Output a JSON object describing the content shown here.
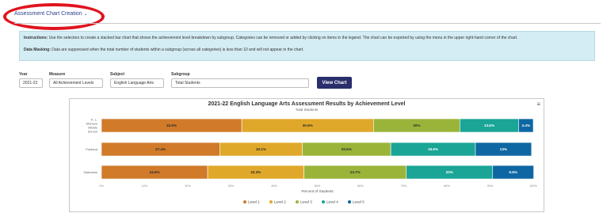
{
  "header": {
    "title": "Assessment Chart Creation",
    "chevron": "⌄"
  },
  "info": {
    "instructions_label": "Instructions:",
    "instructions_text": "Use the selectors to create a stacked bar chart that shows the achievement level breakdown by subgroup. Categories can be removed or added by clicking on items in the legend. The chart can be exported by using the menu in the upper right-hand corner of the chart.",
    "masking_label": "Data Masking:",
    "masking_text": "Data are suppressed when the total number of students within a subgroup (across all categories) is less than 10 and will not appear in the chart."
  },
  "filters": {
    "year": {
      "label": "Year",
      "value": "2021-22"
    },
    "measure": {
      "label": "Measure",
      "value": "All Achievement Levels"
    },
    "subject": {
      "label": "Subject",
      "value": "English Language Arts"
    },
    "subgroup": {
      "label": "Subgroup",
      "value": "Total Students"
    }
  },
  "view_button": "View Chart",
  "colors": {
    "Level 1": "#d07a2a",
    "Level 2": "#e0a82a",
    "Level 3": "#9ab43a",
    "Level 4": "#1aa596",
    "Level 5": "#0e67a3"
  },
  "chart_data": {
    "type": "bar",
    "orientation": "horizontal",
    "stacked": true,
    "title": "2021-22 English Language Arts Assessment Results by Achievement Level",
    "subtitle": "Total Students",
    "xlabel": "Percent of Students",
    "xlim": [
      0,
      100
    ],
    "x_ticks": [
      "0%",
      "10%",
      "20%",
      "30%",
      "40%",
      "50%",
      "60%",
      "70%",
      "80%",
      "90%",
      "100%"
    ],
    "categories": [
      [
        "K. L.",
        "Mohave",
        "Middle",
        "School"
      ],
      [
        "Portland"
      ],
      [
        "Statewide"
      ]
    ],
    "series": [
      {
        "name": "Level 1",
        "values": [
          32.5,
          27.4,
          24.6
        ],
        "labels": [
          "32.5%",
          "27.4%",
          "24.6%"
        ]
      },
      {
        "name": "Level 2",
        "values": [
          30.5,
          19.1,
          22.3
        ],
        "labels": [
          "30.5%",
          "19.1%",
          "22.3%"
        ]
      },
      {
        "name": "Level 3",
        "values": [
          20,
          20.5,
          23.7
        ],
        "labels": [
          "20%",
          "20.5%",
          "23.7%"
        ]
      },
      {
        "name": "Level 4",
        "values": [
          13.6,
          19.6,
          20
        ],
        "labels": [
          "13.6%",
          "19.6%",
          "20%"
        ]
      },
      {
        "name": "Level 5",
        "values": [
          3.4,
          13,
          9.5
        ],
        "labels": [
          "3.4%",
          "13%",
          "9.5%"
        ]
      }
    ],
    "legend": "bottom"
  }
}
